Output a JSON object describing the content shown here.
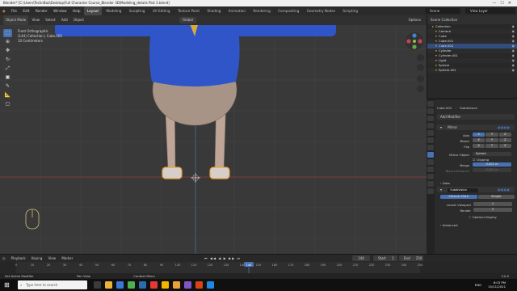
{
  "window": {
    "title": "Blender* [C:\\Users\\TechnBaz\\Desktop\\Full Character Course_Blender 3D\\Modeling_details Part 2.blend]",
    "controls": [
      "—",
      "☐",
      "✕"
    ]
  },
  "menu": [
    "File",
    "Edit",
    "Render",
    "Window",
    "Help"
  ],
  "workspaces": [
    "Layout",
    "Modeling",
    "Sculpting",
    "UV Editing",
    "Texture Paint",
    "Shading",
    "Animation",
    "Rendering",
    "Compositing",
    "Geometry Nodes",
    "Scripting"
  ],
  "active_workspace": "Layout",
  "scene": "Scene",
  "view_layer": "View Layer",
  "viewport_header": {
    "mode": "Object Mode",
    "items": [
      "View",
      "Select",
      "Add",
      "Object"
    ],
    "transform": "Global",
    "options": "Options"
  },
  "viewport_info": {
    "view": "Front Orthographic",
    "collection": "(144) Collection | Cube.002",
    "scale": "10 Centimeters"
  },
  "outliner": {
    "header": "Scene Collection",
    "rows": [
      {
        "name": "Collection",
        "selected": false
      },
      {
        "name": "Camera",
        "selected": false
      },
      {
        "name": "Cube",
        "selected": false
      },
      {
        "name": "Cube.001",
        "selected": false
      },
      {
        "name": "Cube.002",
        "selected": true
      },
      {
        "name": "Cylinder",
        "selected": false
      },
      {
        "name": "Cylinder.001",
        "selected": false
      },
      {
        "name": "Light",
        "selected": false
      },
      {
        "name": "Sphere",
        "selected": false
      },
      {
        "name": "Sphere.001",
        "selected": false
      }
    ]
  },
  "properties": {
    "object_name": "Cube.002",
    "modifier_name": "Subdivision",
    "add_modifier": "Add Modifier",
    "mirror": {
      "name": "Mirror",
      "axis_label": "Axis",
      "bisect_label": "Bisect",
      "flip_label": "Flip",
      "axes": [
        "X",
        "Y",
        "Z"
      ],
      "mirror_object_label": "Mirror Object",
      "mirror_object": "Sphere",
      "clipping_label": "Clipping",
      "merge_label": "Merge",
      "merge_value": "0.001 m",
      "bisect_distance_label": "Bisect Distance",
      "bisect_distance_value": "0.001 m",
      "data_label": "Data"
    },
    "subdivision": {
      "name": "Subdivision",
      "tabs": [
        "Catmull-Clark",
        "Simple"
      ],
      "levels_viewport_label": "Levels Viewport",
      "levels_viewport": "1",
      "render_label": "Render",
      "render": "2",
      "optimal_display_label": "Optimal Display",
      "advanced_label": "Advanced"
    }
  },
  "timeline": {
    "menus": [
      "Playback",
      "Keying",
      "View",
      "Marker"
    ],
    "current_frame": "144",
    "start_label": "Start",
    "start": "1",
    "end_label": "End",
    "end": "250",
    "ticks": [
      "0",
      "10",
      "20",
      "30",
      "40",
      "50",
      "60",
      "70",
      "80",
      "90",
      "100",
      "110",
      "120",
      "130",
      "140",
      "150",
      "160",
      "170",
      "180",
      "190",
      "200",
      "210",
      "220",
      "230",
      "240",
      "250"
    ],
    "playhead_frame": 144
  },
  "statusbar": {
    "left": "Set Active Modifier",
    "middle1": "Pan View",
    "middle2": "Context Menu",
    "version": "3.0.0"
  },
  "taskbar": {
    "search_placeholder": "Type here to search",
    "time": "8:03 PM",
    "date": "15/11/2021",
    "lang": "ENG"
  },
  "colors": {
    "accent": "#4772b3",
    "shirt": "#2f55c9",
    "body": "#bfa597",
    "selection": "#e8a23c",
    "x_axis": "#9a3b44",
    "y_axis": "#4a6d8a"
  }
}
